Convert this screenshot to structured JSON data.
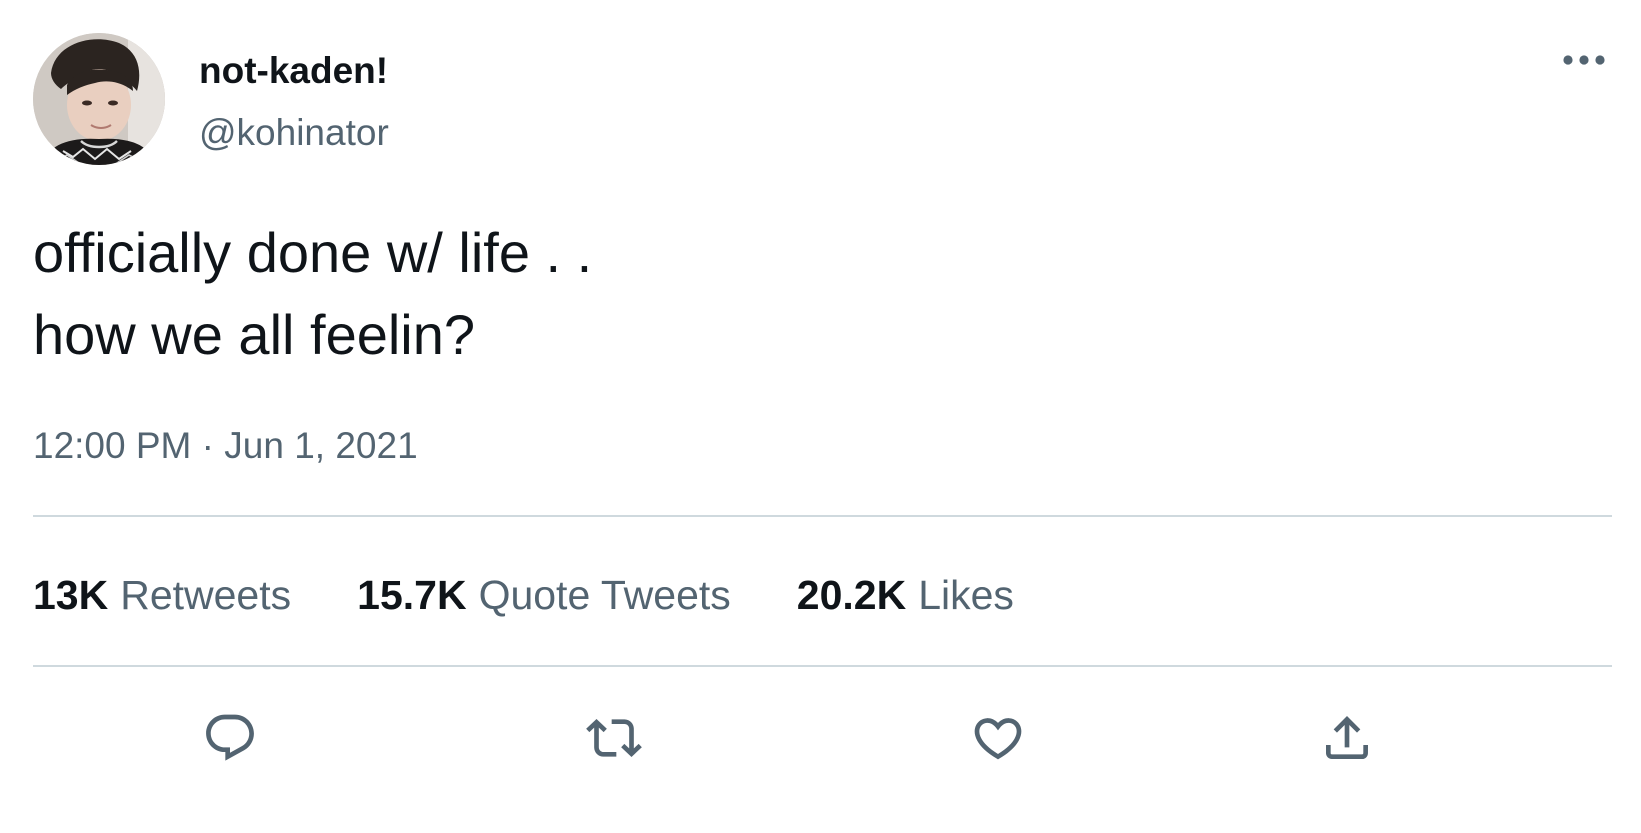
{
  "user": {
    "display_name": "not-kaden!",
    "handle": "@kohinator",
    "avatar_icon": "profile-photo"
  },
  "tweet": {
    "lines": [
      "officially done w/ life . .",
      "how we all feelin?"
    ],
    "time": "12:00 PM",
    "separator": "·",
    "date": "Jun 1, 2021"
  },
  "stats": {
    "retweets_count": "13K",
    "retweets_label": "Retweets",
    "quotes_count": "15.7K",
    "quotes_label": "Quote Tweets",
    "likes_count": "20.2K",
    "likes_label": "Likes"
  },
  "icons": {
    "more": "more-horizontal-icon",
    "reply": "reply-icon",
    "retweet": "retweet-icon",
    "like": "heart-icon",
    "share": "share-icon"
  },
  "colors": {
    "text_primary": "#0f1419",
    "text_secondary": "#536471",
    "divider": "#cfd9de"
  }
}
